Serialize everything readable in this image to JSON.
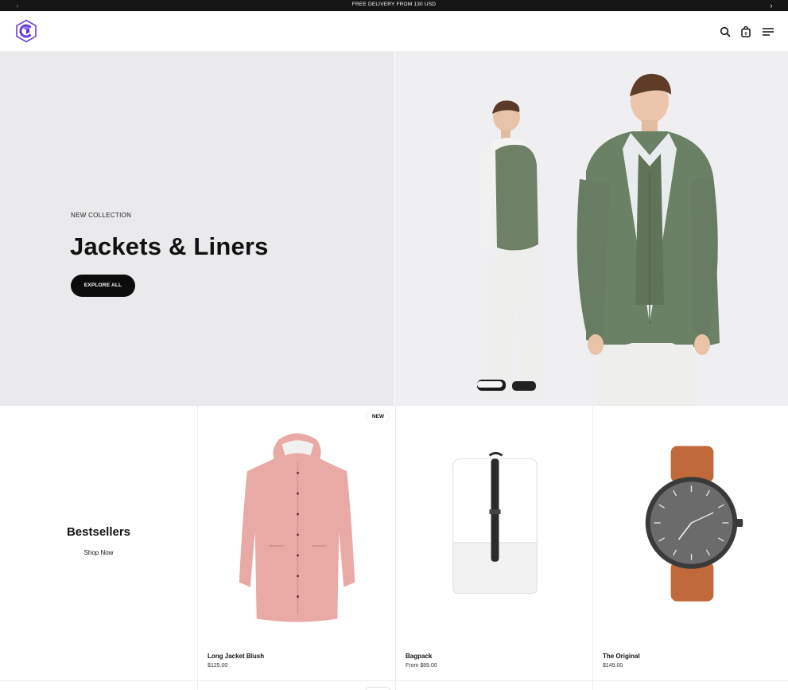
{
  "announcement": {
    "text": "FREE DELIVERY FROM 130 USD",
    "prev_icon": "‹",
    "next_icon": "›"
  },
  "header": {
    "logo_icon": "cube-logo-icon",
    "icons": [
      "search-icon",
      "cart-icon",
      "menu-icon"
    ],
    "cart_count": "0",
    "brand_color": "#6a3fd6"
  },
  "hero": {
    "subtitle": "NEW COLLECTION",
    "title": "Jackets & Liners",
    "button_label": "EXPLORE ALL"
  },
  "bestsellers": {
    "title": "Bestsellers",
    "link": "Shop Now"
  },
  "products": [
    {
      "name": "Long Jacket Blush",
      "price": "$125.00",
      "badge": "NEW",
      "image": "pink-raincoat"
    },
    {
      "name": "Bagpack",
      "price": "From $89.00",
      "badge": "",
      "image": "white-backpack"
    },
    {
      "name": "The Original",
      "price": "$149.00",
      "badge": "",
      "image": "brown-strap-watch"
    }
  ]
}
